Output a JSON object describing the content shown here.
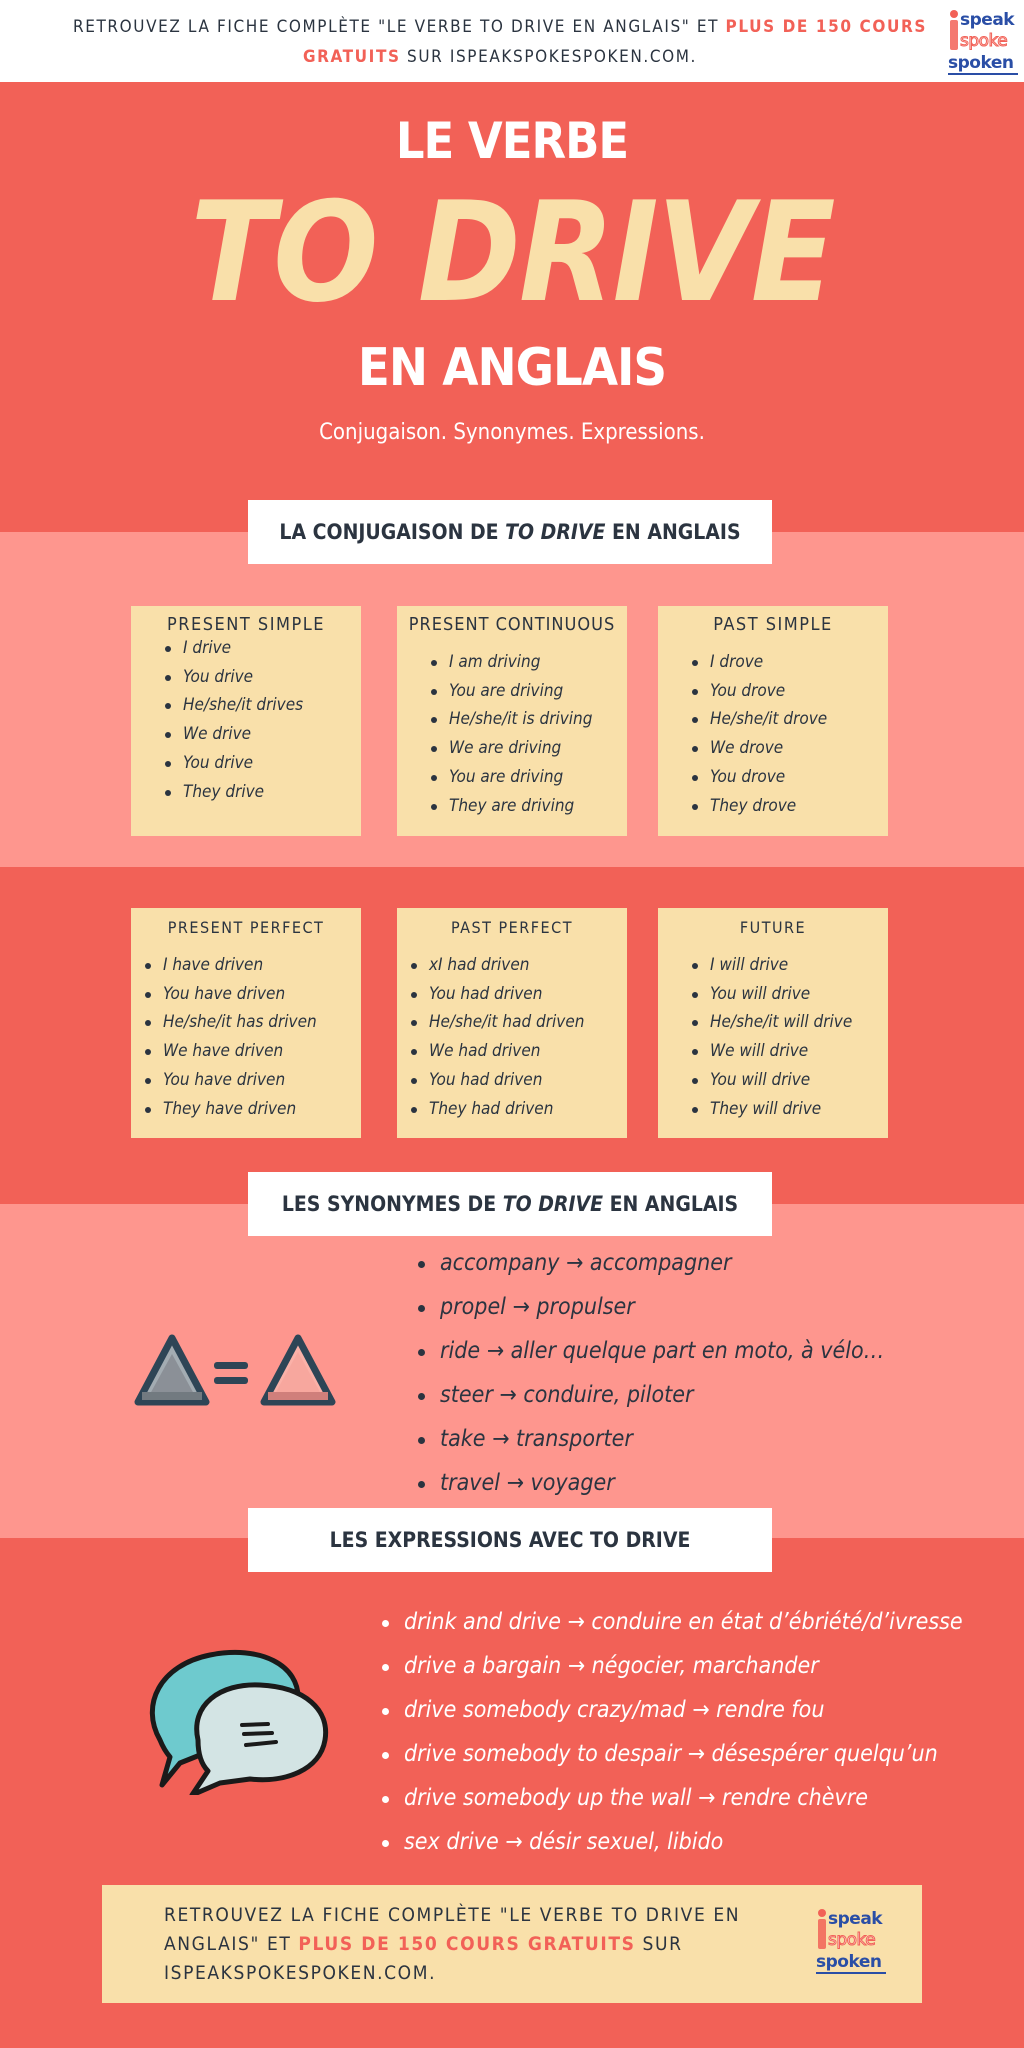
{
  "top_banner": {
    "text_before": "RETROUVEZ LA FICHE COMPLÈTE \"LE VERBE TO DRIVE  EN ANGLAIS\" ET ",
    "highlight": "PLUS DE 150 COURS GRATUITS",
    "text_after": " SUR ISPEAKSPOKESPOKEN.COM."
  },
  "logo": {
    "line1": "speak",
    "line2": "spoke",
    "line3": "spoken"
  },
  "hero": {
    "line1": "LE VERBE",
    "line2": "TO DRIVE",
    "line3": "EN ANGLAIS",
    "subtitle": "Conjugaison. Synonymes.  Expressions."
  },
  "conjugation": {
    "heading_before": "LA CONJUGAISON DE ",
    "heading_italic": "TO DRIVE",
    "heading_after": "  EN ANGLAIS",
    "tenses": [
      {
        "title": "PRESENT SIMPLE",
        "forms": [
          "I drive",
          "You drive",
          "He/she/it drives",
          "We drive",
          "You drive",
          "They drive"
        ]
      },
      {
        "title": "PRESENT CONTINUOUS",
        "forms": [
          "I am driving",
          "You are driving",
          "He/she/it is driving",
          "We are driving",
          "You are driving",
          "They are driving"
        ]
      },
      {
        "title": "PAST SIMPLE",
        "forms": [
          "I drove",
          "You drove",
          "He/she/it drove",
          "We drove",
          "You drove",
          "They drove"
        ]
      },
      {
        "title": "PRESENT PERFECT",
        "forms": [
          "I have driven",
          "You have driven",
          "He/she/it has driven",
          "We have driven",
          "You have driven",
          "They have driven"
        ]
      },
      {
        "title": "PAST PERFECT",
        "forms": [
          "xI had driven",
          "You had driven",
          "He/she/it had driven",
          "We had driven",
          "You had driven",
          "They had driven"
        ]
      },
      {
        "title": "FUTURE",
        "forms": [
          "I will drive",
          "You will drive",
          "He/she/it will drive",
          "We will drive",
          "You will drive",
          "They will drive"
        ]
      }
    ]
  },
  "synonyms": {
    "heading_before": "LES SYNONYMES DE ",
    "heading_italic": "TO DRIVE",
    "heading_after": " EN ANGLAIS",
    "icon": "equals-triangles-icon",
    "items": [
      "accompany → accompagner",
      "propel → propulser",
      "ride → aller quelque part en moto, à vélo…",
      "steer → conduire, piloter",
      "take → transporter",
      "travel → voyager"
    ]
  },
  "expressions": {
    "heading": "LES EXPRESSIONS AVEC TO DRIVE",
    "icon": "speech-bubbles-icon",
    "items": [
      "drink and drive → conduire en état d’ébriété/d’ivresse",
      "drive a bargain → négocier, marchander",
      "drive somebody crazy/mad → rendre fou",
      "drive somebody to despair → désespérer quelqu’un",
      "drive somebody up the wall → rendre chèvre",
      "sex drive → désir sexuel, libido"
    ]
  },
  "footer_banner": {
    "text_before": "RETROUVEZ LA FICHE COMPLÈTE \"LE VERBE TO DRIVE EN ANGLAIS\" ET ",
    "highlight": "PLUS DE 150 COURS GRATUITS",
    "text_after": " SUR ISPEAKSPOKESPOKEN.COM."
  },
  "colors": {
    "coral": "#f26157",
    "pink": "#fe968e",
    "cream": "#f9e0aa",
    "navy": "#2b3440",
    "logo_blue": "#2a4ea6"
  }
}
